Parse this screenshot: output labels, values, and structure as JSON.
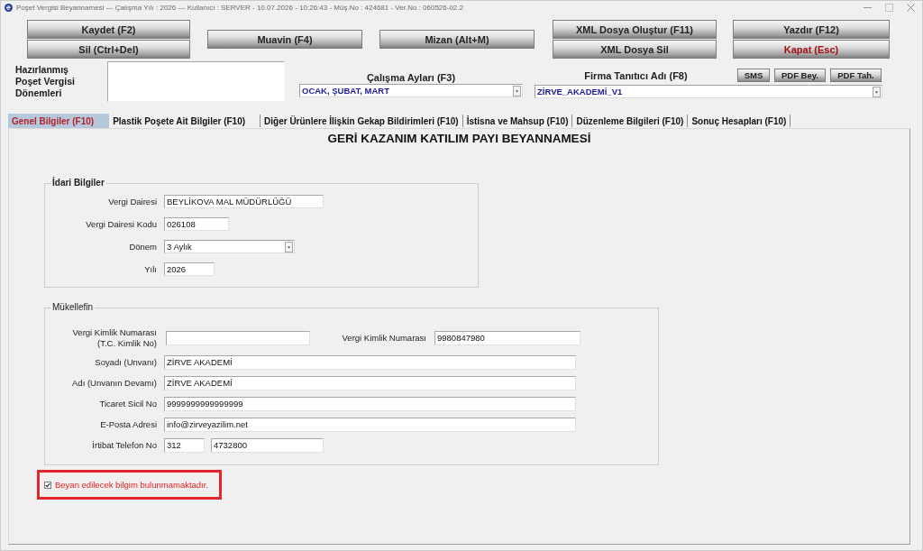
{
  "window": {
    "title": "Poşet Vergisi Beyannamesi --- Çalışma Yılı : 2026 --- Kullanıcı : SERVER - 10.07.2026 - 10:26:43 - Müş.No : 424681 - Ver.No : 060526-02.2"
  },
  "toolbar": [
    {
      "buttons": [
        {
          "label": "Kaydet (F2)",
          "kind": "normal"
        },
        {
          "label": "Sil (Ctrl+Del)",
          "kind": "normal"
        }
      ]
    },
    {
      "buttons": [
        {
          "label": "Muavin (F4)",
          "kind": "normal"
        }
      ]
    },
    {
      "buttons": [
        {
          "label": "Mizan (Alt+M)",
          "kind": "normal"
        }
      ]
    },
    {
      "buttons": [
        {
          "label": "XML Dosya Oluştur (F11)",
          "kind": "normal"
        },
        {
          "label": "XML Dosya Sil",
          "kind": "normal"
        }
      ]
    },
    {
      "buttons": [
        {
          "label": "Yazdır (F12)",
          "kind": "normal"
        },
        {
          "label": "Kapat (Esc)",
          "kind": "exit"
        }
      ]
    }
  ],
  "periods": {
    "label": "Hazırlanmış Poşet Vergisi Dönemleri"
  },
  "working_months": {
    "label": "Çalışma Ayları (F3)",
    "value": "OCAK, ŞUBAT, MART"
  },
  "company": {
    "label": "Firma Tanıtıcı Adı (F8)",
    "buttons": [
      "SMS",
      "PDF Bey.",
      "PDF Tah."
    ],
    "value": "ZİRVE_AKADEMİ_V1"
  },
  "tabs": [
    {
      "label": "Genel Bilgiler (F10)",
      "selected": true
    },
    {
      "label": "Plastik Poşete Ait Bilgiler (F10)",
      "selected": false
    },
    {
      "label": "Diğer Ürünlere İlişkin Gekap Bildirimleri (F10)",
      "selected": false
    },
    {
      "label": "İstisna ve Mahsup (F10)",
      "selected": false
    },
    {
      "label": "Düzenleme Bilgileri (F10)",
      "selected": false
    },
    {
      "label": "Sonuç Hesapları (F10)",
      "selected": false
    }
  ],
  "form_title": "GERİ KAZANIM KATILIM PAYI BEYANNAMESİ",
  "idari_bilgiler": {
    "title": "İdari Bilgiler",
    "rows": [
      {
        "kind": "text",
        "label": "Vergi Dairesi",
        "value": "BEYLİKOVA MAL MÜDÜRLÜĞÜ"
      },
      {
        "kind": "text",
        "label": "Vergi Dairesi Kodu",
        "value": "026108"
      },
      {
        "kind": "dropdown",
        "label": "Dönem",
        "value": "3 Aylık"
      },
      {
        "kind": "text",
        "label": "Yılı",
        "value": "2026"
      }
    ]
  },
  "mukellefin": {
    "title": "Mükellefin",
    "rows": [
      {
        "kind": "pair",
        "label": "Vergi Kimlik Numarası (T.C. Kimlik No)",
        "second_label": "Vergi Kimlik Numarası",
        "second_value": "9980847980"
      },
      {
        "kind": "text",
        "label": "Soyadı (Unvanı)",
        "value": "ZİRVE AKADEMİ"
      },
      {
        "kind": "text",
        "label": "Adı (Unvanın Devamı)",
        "value": "ZİRVE AKADEMİ"
      },
      {
        "kind": "text",
        "label": "Ticaret Sicil No",
        "value": "9999999999999999"
      },
      {
        "kind": "text",
        "label": "E-Posta Adresi",
        "value": "info@zirveyazilim.net"
      },
      {
        "kind": "phone",
        "label": "İrtibat Telefon No",
        "area_code": "312",
        "number": "4732800"
      }
    ]
  },
  "declaration": {
    "label": "Beyan edilecek bilgim bulunmamaktadır.",
    "checked": true
  }
}
